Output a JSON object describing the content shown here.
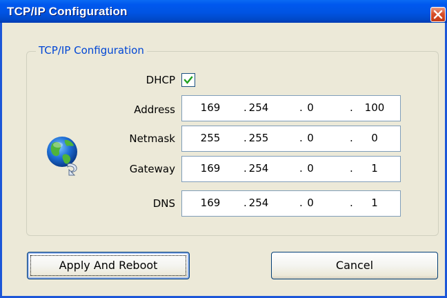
{
  "window": {
    "title": "TCP/IP Configuration"
  },
  "group": {
    "label": "TCP/IP Configuration"
  },
  "dhcp": {
    "label": "DHCP",
    "checked": true
  },
  "fields": {
    "address": {
      "label": "Address",
      "octets": [
        "169",
        "254",
        "0",
        "100"
      ]
    },
    "netmask": {
      "label": "Netmask",
      "octets": [
        "255",
        "255",
        "0",
        "0"
      ]
    },
    "gateway": {
      "label": "Gateway",
      "octets": [
        "169",
        "254",
        "0",
        "1"
      ]
    },
    "dns": {
      "label": "DNS",
      "octets": [
        "169",
        "254",
        "0",
        "1"
      ]
    }
  },
  "separator": ".",
  "buttons": {
    "apply": "Apply And Reboot",
    "cancel": "Cancel"
  },
  "icons": {
    "close": "close-icon",
    "checkbox": "checkmark-icon",
    "network": "network-globe-icon"
  },
  "colors": {
    "titlebar": "#0054e3",
    "group_label": "#0046d5",
    "close_button": "#d8502c",
    "checkmark": "#21a121"
  }
}
